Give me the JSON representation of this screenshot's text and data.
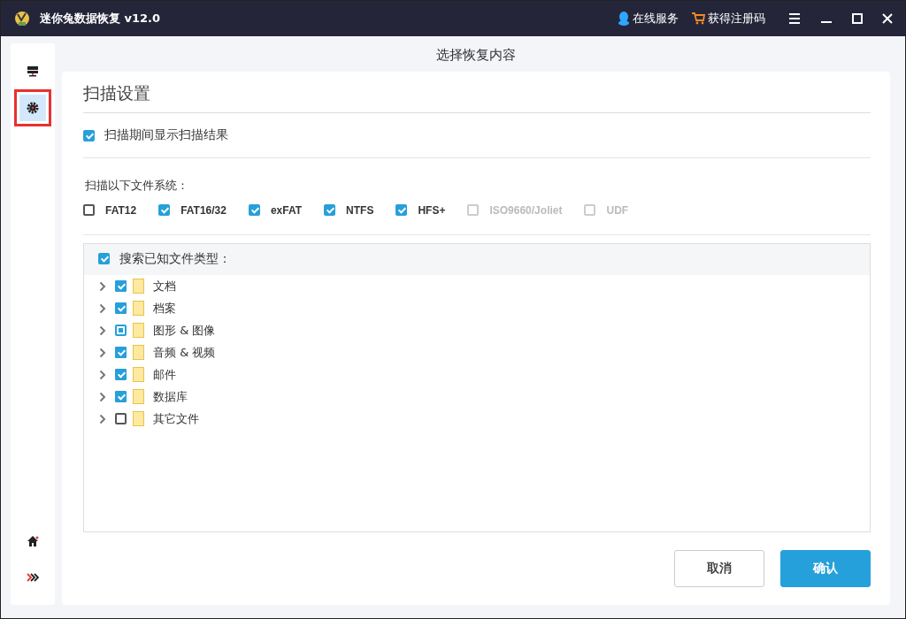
{
  "window": {
    "title": "迷你兔数据恢复 v12.0",
    "links": [
      {
        "kind": "service",
        "label": "在线服务"
      },
      {
        "kind": "cart",
        "label": "获得注册码"
      }
    ]
  },
  "sidebar": {
    "items": [
      {
        "kind": "monitor",
        "selected": false,
        "highlighted": false
      },
      {
        "kind": "gear",
        "selected": true,
        "highlighted": true
      },
      {
        "kind": "home",
        "selected": false,
        "highlighted": false
      },
      {
        "kind": "expand",
        "selected": false,
        "highlighted": false
      }
    ]
  },
  "page_title": "选择恢复内容",
  "section_title": "扫描设置",
  "show_results": {
    "label": "扫描期间显示扫描结果",
    "checked": true
  },
  "fs_label": "扫描以下文件系统：",
  "file_systems": [
    {
      "label": "FAT12",
      "checked": false,
      "disabled": false
    },
    {
      "label": "FAT16/32",
      "checked": true,
      "disabled": false
    },
    {
      "label": "exFAT",
      "checked": true,
      "disabled": false
    },
    {
      "label": "NTFS",
      "checked": true,
      "disabled": false
    },
    {
      "label": "HFS+",
      "checked": true,
      "disabled": false
    },
    {
      "label": "ISO9660/Joliet",
      "checked": false,
      "disabled": true
    },
    {
      "label": "UDF",
      "checked": false,
      "disabled": true
    }
  ],
  "known_types": {
    "label": "搜索已知文件类型：",
    "checked": true,
    "items": [
      {
        "label": "文档",
        "checked": true,
        "partial": false,
        "expanded": false
      },
      {
        "label": "档案",
        "checked": true,
        "partial": false,
        "expanded": false
      },
      {
        "label": "图形 & 图像",
        "checked": false,
        "partial": true,
        "expanded": false
      },
      {
        "label": "音频 & 视频",
        "checked": true,
        "partial": false,
        "expanded": false
      },
      {
        "label": "邮件",
        "checked": true,
        "partial": false,
        "expanded": false
      },
      {
        "label": "数据库",
        "checked": true,
        "partial": false,
        "expanded": false
      },
      {
        "label": "其它文件",
        "checked": false,
        "partial": false,
        "expanded": false
      }
    ]
  },
  "buttons": [
    {
      "kind": "secondary",
      "label": "取消"
    },
    {
      "kind": "primary",
      "label": "确认"
    }
  ]
}
